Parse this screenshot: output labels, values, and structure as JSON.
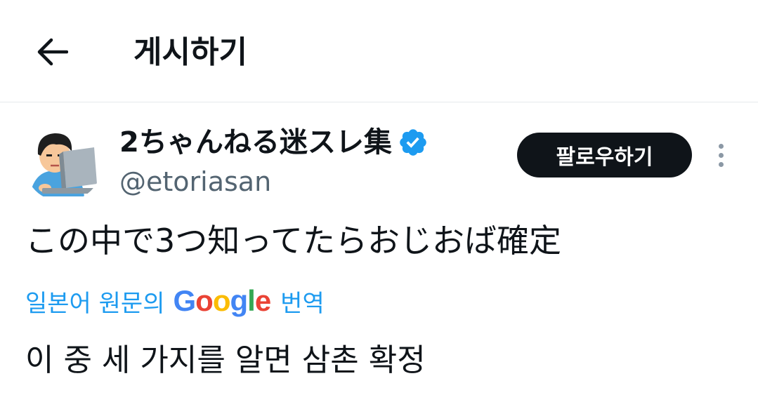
{
  "header": {
    "back_icon": "arrow-left-icon",
    "title": "게시하기"
  },
  "author": {
    "display_name": "2ちゃんねる迷スレ集",
    "verified_icon": "verified-badge-icon",
    "verified_color": "#1d9bf0",
    "handle": "@etoriasan",
    "follow_label": "팔로우하기",
    "more_icon": "more-vertical-icon"
  },
  "tweet": {
    "text": "この中で3つ知ってたらおじおば確定",
    "translate_prefix": "일본어 원문의",
    "google_letters": [
      "G",
      "o",
      "o",
      "g",
      "l",
      "e"
    ],
    "google_colors": [
      "#4285F4",
      "#EA4335",
      "#FBBC05",
      "#4285F4",
      "#34A853",
      "#EA4335"
    ],
    "translate_suffix": "번역",
    "translated_text": "이 중 세 가지를 알면 삼촌 확정"
  },
  "colors": {
    "text": "#0f1419",
    "secondary": "#536471",
    "link": "#1d9bf0",
    "follow_bg": "#0f1419",
    "follow_text": "#ffffff"
  }
}
